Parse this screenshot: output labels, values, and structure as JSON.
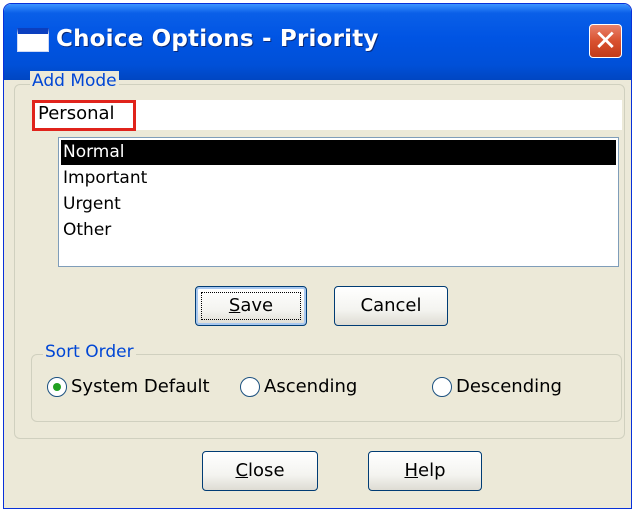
{
  "window": {
    "title": "Choice Options - Priority",
    "close_glyph": "✕"
  },
  "add_mode": {
    "legend": "Add Mode",
    "input_value": "Personal",
    "list_items": [
      "Normal",
      "Important",
      "Urgent",
      "Other"
    ],
    "selected_item": "Normal"
  },
  "buttons": {
    "save": {
      "mnemonic": "S",
      "rest": "ave"
    },
    "cancel": "Cancel",
    "close": {
      "mnemonic": "C",
      "rest": "lose"
    },
    "help": {
      "mnemonic": "H",
      "rest": "elp"
    }
  },
  "sort_order": {
    "legend": "Sort Order",
    "options": [
      "System Default",
      "Ascending",
      "Descending"
    ],
    "selected": "System Default"
  },
  "colors": {
    "titlebar": "#0054e3",
    "window_bg": "#ece9d8",
    "legend_text": "#0046d5",
    "highlight_annotation": "#e0231b",
    "radio_dot": "#21a121"
  },
  "icons": {
    "app": "window-icon",
    "close": "close-icon"
  }
}
